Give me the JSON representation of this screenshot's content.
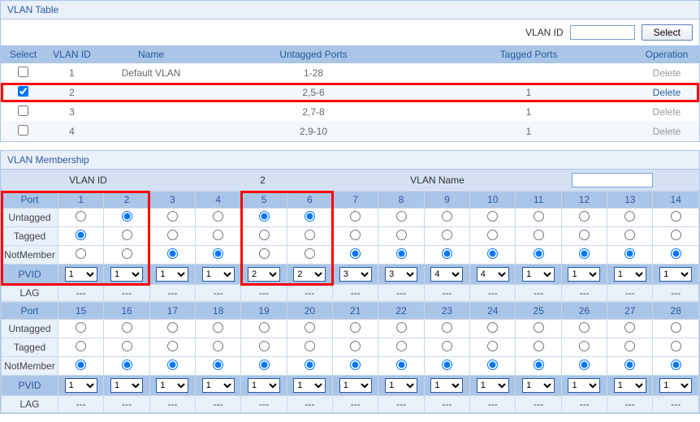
{
  "vlanTable": {
    "title": "VLAN Table",
    "filterLabel": "VLAN ID",
    "selectBtn": "Select",
    "headers": {
      "select": "Select",
      "vlanid": "VLAN ID",
      "name": "Name",
      "untagged": "Untagged Ports",
      "tagged": "Tagged Ports",
      "operation": "Operation"
    },
    "rows": [
      {
        "checked": false,
        "vlanid": "1",
        "name": "Default VLAN",
        "untagged": "1-28",
        "tagged": "",
        "op": "Delete",
        "opEnabled": false,
        "highlight": false
      },
      {
        "checked": true,
        "vlanid": "2",
        "name": "",
        "untagged": "2,5-6",
        "tagged": "1",
        "op": "Delete",
        "opEnabled": true,
        "highlight": true
      },
      {
        "checked": false,
        "vlanid": "3",
        "name": "",
        "untagged": "2,7-8",
        "tagged": "1",
        "op": "Delete",
        "opEnabled": false,
        "highlight": false
      },
      {
        "checked": false,
        "vlanid": "4",
        "name": "",
        "untagged": "2,9-10",
        "tagged": "1",
        "op": "Delete",
        "opEnabled": false,
        "highlight": false
      }
    ]
  },
  "membership": {
    "title": "VLAN Membership",
    "vlanIdLabel": "VLAN ID",
    "vlanIdValue": "2",
    "vlanNameLabel": "VLAN Name",
    "vlanNameValue": "",
    "rowLabels": {
      "port": "Port",
      "untagged": "Untagged",
      "tagged": "Tagged",
      "notmember": "NotMember",
      "pvid": "PVID",
      "lag": "LAG"
    },
    "highlightCols1": [
      1,
      2
    ],
    "highlightCols2": [
      5,
      6
    ],
    "ports": [
      {
        "port": 1,
        "state": "tagged",
        "pvid": "1",
        "lag": "---"
      },
      {
        "port": 2,
        "state": "untagged",
        "pvid": "1",
        "lag": "---"
      },
      {
        "port": 3,
        "state": "notmember",
        "pvid": "1",
        "lag": "---"
      },
      {
        "port": 4,
        "state": "notmember",
        "pvid": "1",
        "lag": "---"
      },
      {
        "port": 5,
        "state": "untagged",
        "pvid": "2",
        "lag": "---"
      },
      {
        "port": 6,
        "state": "untagged",
        "pvid": "2",
        "lag": "---"
      },
      {
        "port": 7,
        "state": "notmember",
        "pvid": "3",
        "lag": "---"
      },
      {
        "port": 8,
        "state": "notmember",
        "pvid": "3",
        "lag": "---"
      },
      {
        "port": 9,
        "state": "notmember",
        "pvid": "4",
        "lag": "---"
      },
      {
        "port": 10,
        "state": "notmember",
        "pvid": "4",
        "lag": "---"
      },
      {
        "port": 11,
        "state": "notmember",
        "pvid": "1",
        "lag": "---"
      },
      {
        "port": 12,
        "state": "notmember",
        "pvid": "1",
        "lag": "---"
      },
      {
        "port": 13,
        "state": "notmember",
        "pvid": "1",
        "lag": "---"
      },
      {
        "port": 14,
        "state": "notmember",
        "pvid": "1",
        "lag": "---"
      },
      {
        "port": 15,
        "state": "notmember",
        "pvid": "1",
        "lag": "---"
      },
      {
        "port": 16,
        "state": "notmember",
        "pvid": "1",
        "lag": "---"
      },
      {
        "port": 17,
        "state": "notmember",
        "pvid": "1",
        "lag": "---"
      },
      {
        "port": 18,
        "state": "notmember",
        "pvid": "1",
        "lag": "---"
      },
      {
        "port": 19,
        "state": "notmember",
        "pvid": "1",
        "lag": "---"
      },
      {
        "port": 20,
        "state": "notmember",
        "pvid": "1",
        "lag": "---"
      },
      {
        "port": 21,
        "state": "notmember",
        "pvid": "1",
        "lag": "---"
      },
      {
        "port": 22,
        "state": "notmember",
        "pvid": "1",
        "lag": "---"
      },
      {
        "port": 23,
        "state": "notmember",
        "pvid": "1",
        "lag": "---"
      },
      {
        "port": 24,
        "state": "notmember",
        "pvid": "1",
        "lag": "---"
      },
      {
        "port": 25,
        "state": "notmember",
        "pvid": "1",
        "lag": "---"
      },
      {
        "port": 26,
        "state": "notmember",
        "pvid": "1",
        "lag": "---"
      },
      {
        "port": 27,
        "state": "notmember",
        "pvid": "1",
        "lag": "---"
      },
      {
        "port": 28,
        "state": "notmember",
        "pvid": "1",
        "lag": "---"
      }
    ]
  }
}
